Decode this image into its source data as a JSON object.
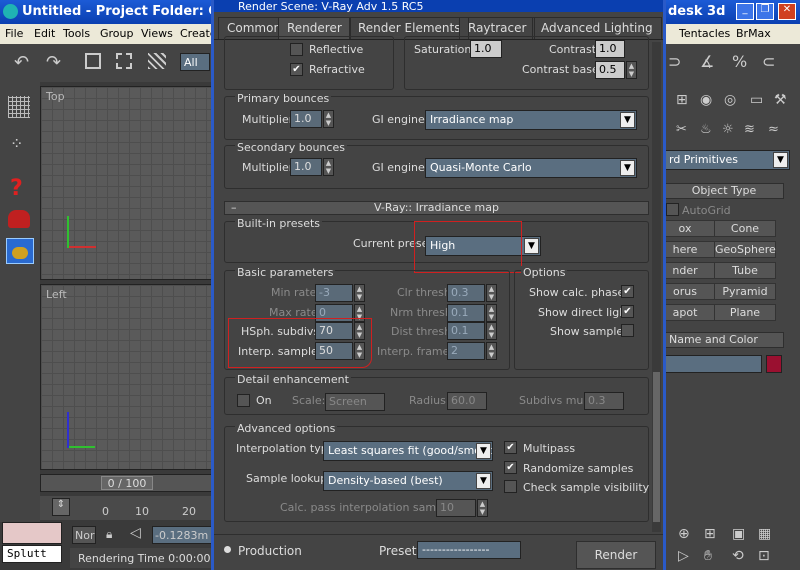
{
  "max": {
    "title": "Untitled    - Project Folder: C",
    "title_right": "desk 3d",
    "menu": [
      "File",
      "Edit",
      "Tools",
      "Group",
      "Views",
      "Create"
    ],
    "menu_right": [
      "Tentacles",
      "BrMax"
    ],
    "toolbar_all": "All",
    "vp_top_label": "Top",
    "vp_left_label": "Left",
    "frame_counter": "0 / 100",
    "ruler": [
      "0",
      "10",
      "20"
    ],
    "script_label": "Splutt",
    "status": "Rendering Time  0:00:00",
    "coord": "-0.1283m",
    "none_label": "Nor"
  },
  "right_panel": {
    "dropdown": "rd Primitives",
    "object_type_title": "Object Type",
    "autogrid": "AutoGrid",
    "buttons": [
      "ox",
      "Cone",
      "here",
      "GeoSphere",
      "nder",
      "Tube",
      "orus",
      "Pyramid",
      "apot",
      "Plane"
    ],
    "name_color_title": "Name and Color"
  },
  "dialog": {
    "title": "Render Scene: V-Ray Adv 1.5 RC5",
    "tabs": [
      "Common",
      "Renderer",
      "Render Elements",
      "Raytracer",
      "Advanced Lighting"
    ],
    "reflective": "Reflective",
    "refractive": "Refractive",
    "saturation_label": "Saturation:",
    "saturation": "1.0",
    "contrast_label": "Contrast:",
    "contrast": "1.0",
    "contrast_base_label": "Contrast base:",
    "contrast_base": "0.5",
    "primary": {
      "title": "Primary bounces",
      "mult_label": "Multiplier:",
      "mult": "1.0",
      "gi_label": "GI engine:",
      "gi": "Irradiance map"
    },
    "secondary": {
      "title": "Secondary bounces",
      "mult_label": "Multiplier:",
      "mult": "1.0",
      "gi_label": "GI engine:",
      "gi": "Quasi-Monte Carlo"
    },
    "irr_rollout": "V-Ray:: Irradiance map",
    "presets_title": "Built-in presets",
    "preset_label": "Current preset:",
    "preset": "High",
    "basic_title": "Basic parameters",
    "min_rate_label": "Min rate:",
    "min_rate": "-3",
    "max_rate_label": "Max rate:",
    "max_rate": "0",
    "hsph_label": "HSph. subdivs:",
    "hsph": "70",
    "interp_label": "Interp. samples:",
    "interp": "50",
    "clr_label": "Clr thresh:",
    "clr": "0.3",
    "nrm_label": "Nrm thresh:",
    "nrm": "0.1",
    "dist_label": "Dist thresh:",
    "dist": "0.1",
    "frames_label": "Interp. frames:",
    "frames": "2",
    "options_title": "Options",
    "opt_calc": "Show calc. phase",
    "opt_direct": "Show direct light",
    "opt_samples": "Show samples",
    "detail_title": "Detail enhancement",
    "on_label": "On",
    "scale_label": "Scale:",
    "scale": "Screen",
    "radius_label": "Radius:",
    "radius": "60.0",
    "subdivs_mult_label": "Subdivs mult.",
    "subdivs_mult": "0.3",
    "adv_title": "Advanced options",
    "interp_type_label": "Interpolation type:",
    "interp_type": "Least squares fit (good/smooth",
    "lookup_label": "Sample lookup:",
    "lookup": "Density-based (best)",
    "multipass": "Multipass",
    "randomize": "Randomize samples",
    "check_vis": "Check sample visibility",
    "calc_pass_label": "Calc. pass interpolation samples:",
    "calc_pass": "10",
    "production": "Production",
    "preset_bottom_label": "Preset:",
    "preset_bottom": "-----------------",
    "render_btn": "Render"
  },
  "colors": {
    "redbox": "#d02020",
    "titlebar": "#0a3fb0"
  }
}
